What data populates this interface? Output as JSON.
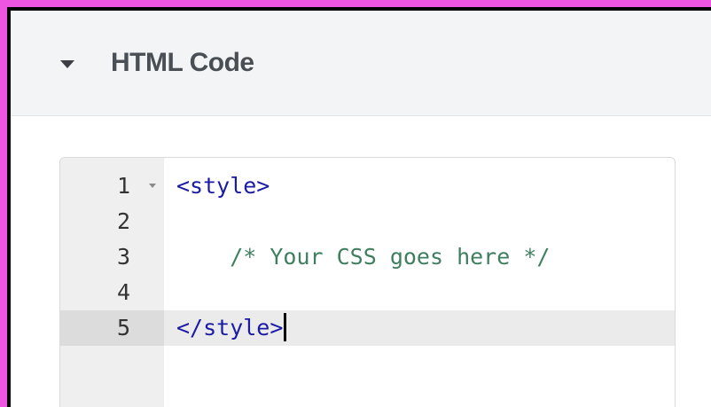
{
  "section": {
    "title": "HTML Code",
    "expanded": true
  },
  "editor": {
    "lines": [
      {
        "number": "1",
        "code": "<style>",
        "kind": "tag",
        "foldable": true
      },
      {
        "number": "2",
        "code": "",
        "kind": "plain"
      },
      {
        "number": "3",
        "code": "    /* Your CSS goes here */",
        "kind": "comment"
      },
      {
        "number": "4",
        "code": "",
        "kind": "plain"
      },
      {
        "number": "5",
        "code": "</style>",
        "kind": "tag",
        "active": true
      }
    ]
  },
  "colors": {
    "page_border": "#ee55e0",
    "tag": "#1a1aa6",
    "comment": "#3f7f5f"
  }
}
